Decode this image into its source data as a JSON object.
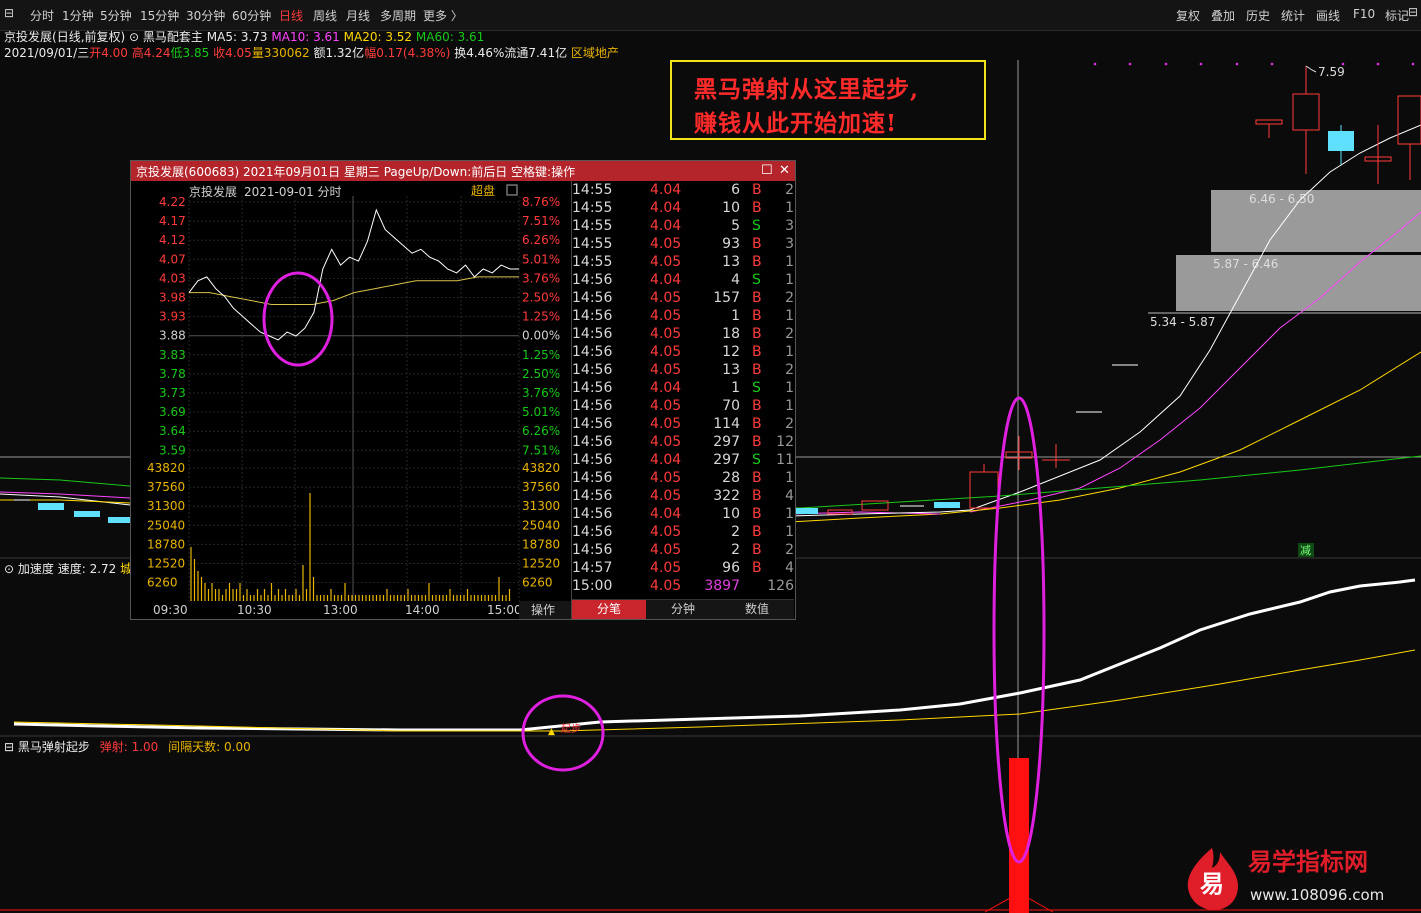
{
  "toolbar": {
    "periods": [
      "分时",
      "1分钟",
      "5分钟",
      "15分钟",
      "30分钟",
      "60分钟",
      "日线",
      "周线",
      "月线",
      "多周期",
      "更多 〉"
    ],
    "active_period": "日线",
    "right_items": [
      "复权",
      "叠加",
      "历史",
      "统计",
      "画线",
      "F10",
      "标记"
    ]
  },
  "header": {
    "stock": "京投发展",
    "mode": "(日线,前复权)",
    "indicator": "黑马配套主",
    "ma5": "MA5: 3.73",
    "ma10": "MA10: 3.61",
    "ma20": "MA20: 3.52",
    "ma60": "MA60: 3.61",
    "date": "2021/09/01/三",
    "open": "开4.00",
    "high": "高4.24",
    "low": "低3.85",
    "close": "收4.05",
    "volume": "量330062",
    "amount": "额1.32亿",
    "change": "幅0.17(4.38%)",
    "turnover": "换4.46%",
    "float": "流通7.41亿",
    "sector": "区域地产"
  },
  "banner": {
    "line1": "黑马弹射从这里起步,",
    "line2": "赚钱从此开始加速!"
  },
  "main_chart": {
    "price_label_high": "7.59",
    "zones": [
      "6.46 - 6.50",
      "5.87 - 6.46",
      "5.34 - 5.87"
    ],
    "signal_label": "减"
  },
  "popup": {
    "title": "京投发展(600683) 2021年09月01日 星期三 PageUp/Down:前后日 空格键:操作",
    "subtitle_name": "京投发展",
    "subtitle_date": "2021-09-01 分时",
    "subtitle_right": "超盘",
    "price_labels": [
      "4.22",
      "4.17",
      "4.12",
      "4.07",
      "4.03",
      "3.98",
      "3.93",
      "3.88",
      "3.83",
      "3.78",
      "3.73",
      "3.69",
      "3.64",
      "3.59"
    ],
    "pct_labels": [
      "8.76%",
      "7.51%",
      "6.26%",
      "5.01%",
      "3.76%",
      "2.50%",
      "1.25%",
      "0.00%",
      "1.25%",
      "2.50%",
      "3.76%",
      "5.01%",
      "6.26%",
      "7.51%"
    ],
    "vol_labels": [
      "43820",
      "37560",
      "31300",
      "25040",
      "18780",
      "12520",
      "6260"
    ],
    "time_labels": [
      "09:30",
      "10:30",
      "13:00",
      "14:00",
      "15:00"
    ],
    "op_label": "操作",
    "ticks": [
      [
        "14:55",
        "4.04",
        "6",
        "B",
        "2"
      ],
      [
        "14:55",
        "4.04",
        "10",
        "B",
        "1"
      ],
      [
        "14:55",
        "4.04",
        "5",
        "S",
        "3"
      ],
      [
        "14:55",
        "4.05",
        "93",
        "B",
        "3"
      ],
      [
        "14:55",
        "4.05",
        "13",
        "B",
        "1"
      ],
      [
        "14:56",
        "4.04",
        "4",
        "S",
        "1"
      ],
      [
        "14:56",
        "4.05",
        "157",
        "B",
        "2"
      ],
      [
        "14:56",
        "4.05",
        "1",
        "B",
        "1"
      ],
      [
        "14:56",
        "4.05",
        "18",
        "B",
        "2"
      ],
      [
        "14:56",
        "4.05",
        "12",
        "B",
        "1"
      ],
      [
        "14:56",
        "4.05",
        "13",
        "B",
        "2"
      ],
      [
        "14:56",
        "4.04",
        "1",
        "S",
        "1"
      ],
      [
        "14:56",
        "4.05",
        "70",
        "B",
        "1"
      ],
      [
        "14:56",
        "4.05",
        "114",
        "B",
        "2"
      ],
      [
        "14:56",
        "4.05",
        "297",
        "B",
        "12"
      ],
      [
        "14:56",
        "4.04",
        "297",
        "S",
        "11"
      ],
      [
        "14:56",
        "4.05",
        "28",
        "B",
        "1"
      ],
      [
        "14:56",
        "4.05",
        "322",
        "B",
        "4"
      ],
      [
        "14:56",
        "4.04",
        "10",
        "B",
        "1"
      ],
      [
        "14:56",
        "4.05",
        "2",
        "B",
        "1"
      ],
      [
        "14:56",
        "4.05",
        "2",
        "B",
        "2"
      ],
      [
        "14:57",
        "4.05",
        "96",
        "B",
        "4"
      ],
      [
        "15:00",
        "4.05",
        "3897",
        "",
        "126"
      ]
    ],
    "tabs": [
      "分笔",
      "分钟",
      "数值"
    ],
    "active_tab": "分笔"
  },
  "indicator1": {
    "name": "加速度",
    "speed_label": "速度: 2.72",
    "extra": "城",
    "mark_label": "起步"
  },
  "indicator2": {
    "name": "黑马弹射起步",
    "launch": "弹射: 1.00",
    "interval": "间隔天数: 0.00"
  },
  "watermark": {
    "logo_char": "易",
    "name": "易学指标网",
    "url": "www.108096.com"
  },
  "colors": {
    "up": "#ff3b3b",
    "down": "#18c818",
    "ma5": "#ffffff",
    "ma10": "#ff44ff",
    "ma20": "#ffd800",
    "ma60": "#18c818",
    "highlight": "#e020e0"
  }
}
